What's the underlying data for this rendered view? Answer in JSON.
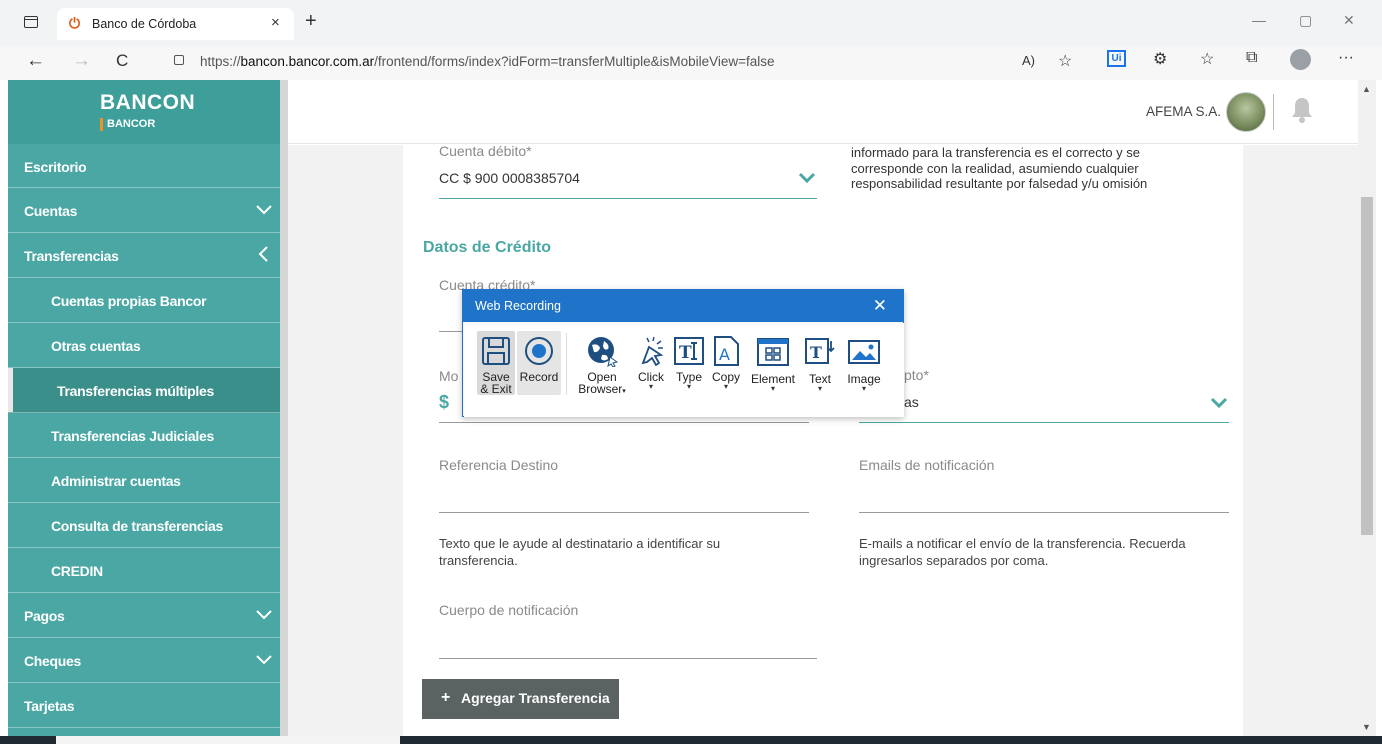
{
  "browser": {
    "tab_title": "Banco de Córdoba",
    "url_prefix": "https://",
    "url_host": "bancon.bancor.com.ar",
    "url_path": "/frontend/forms/index?idForm=transferMultiple&isMobileView=false",
    "new_tab": "+",
    "tab_close": "×",
    "back": "←",
    "forward": "→",
    "reload": "C",
    "minimize": "—",
    "restore": "▢",
    "close": "✕",
    "read_aloud": "A)",
    "favorites_add": "☆",
    "extension_label": "Ui",
    "extensions": "⚙",
    "favorites": "☆",
    "collections": "⧉",
    "more": "···"
  },
  "sidebar": {
    "logo_main": "BANCON",
    "logo_sub": "BANCOR",
    "items": [
      {
        "label": "Escritorio",
        "chevron": "none"
      },
      {
        "label": "Cuentas",
        "chevron": "down"
      },
      {
        "label": "Transferencias",
        "chevron": "left"
      },
      {
        "label": "Cuentas propias Bancor",
        "chevron": "none"
      },
      {
        "label": "Otras cuentas",
        "chevron": "none"
      },
      {
        "label": "Transferencias múltiples",
        "chevron": "none"
      },
      {
        "label": "Transferencias Judiciales",
        "chevron": "none"
      },
      {
        "label": "Administrar cuentas",
        "chevron": "none"
      },
      {
        "label": "Consulta de transferencias",
        "chevron": "none"
      },
      {
        "label": "CREDIN",
        "chevron": "none"
      },
      {
        "label": "Pagos",
        "chevron": "down"
      },
      {
        "label": "Cheques",
        "chevron": "down"
      },
      {
        "label": "Tarjetas",
        "chevron": "none"
      }
    ]
  },
  "header": {
    "company": "AFEMA S.A."
  },
  "form": {
    "debit_label": "Cuenta débito*",
    "debit_value": "CC $ 900 0008385704",
    "info_text": "informado para la transferencia es el correcto y se corresponde con la realidad, asumiendo cualquier responsabilidad resultante por falsedad y/u omisión",
    "credit_section_title": "Datos de Crédito",
    "credit_label": "Cuenta crédito*",
    "amount_label_partial": "Mo",
    "currency_symbol": "$",
    "concept_label_partial": "pto*",
    "concept_value_partial": "as",
    "reference_label": "Referencia Destino",
    "reference_help": " Texto que le ayude al destinatario a identificar su transferencia.",
    "emails_label": "Emails de notificación",
    "emails_help": " E-mails a notificar el envío de la transferencia. Recuerda ingresarlos separados por coma.",
    "body_label": "Cuerpo de notificación",
    "add_button": "Agregar Transferencia",
    "add_button_icon": "+"
  },
  "recorder": {
    "title": "Web Recording",
    "close": "✕",
    "buttons": [
      {
        "label": "Save",
        "label2": "& Exit",
        "icon": "save-icon"
      },
      {
        "label": "Record",
        "label2": "",
        "icon": "record-icon"
      },
      {
        "label": "Open",
        "label2": "Browser",
        "icon": "globe-icon"
      },
      {
        "label": "Click",
        "label2": "",
        "icon": "click-icon"
      },
      {
        "label": "Type",
        "label2": "",
        "icon": "type-icon"
      },
      {
        "label": "Copy",
        "label2": "",
        "icon": "copy-icon"
      },
      {
        "label": "Element",
        "label2": "",
        "icon": "element-icon"
      },
      {
        "label": "Text",
        "label2": "",
        "icon": "text-icon"
      },
      {
        "label": "Image",
        "label2": "",
        "icon": "image-icon"
      }
    ]
  },
  "colors": {
    "sidebar": "#4aa7a3",
    "sidebar_active": "#3b8f8b",
    "accent_teal": "#4aa7a3",
    "recorder_blue": "#1f74c9",
    "button_gray": "#5a6262"
  }
}
